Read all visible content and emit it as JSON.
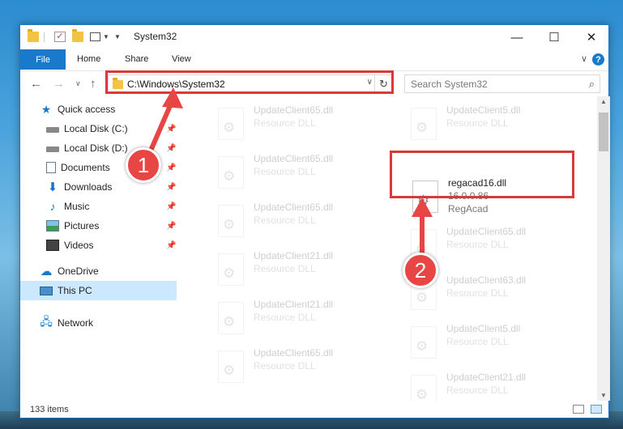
{
  "window": {
    "title": "System32",
    "minimize_glyph": "—",
    "maximize_glyph": "☐",
    "close_glyph": "✕"
  },
  "ribbon": {
    "tabs": [
      {
        "label": "File"
      },
      {
        "label": "Home"
      },
      {
        "label": "Share"
      },
      {
        "label": "View"
      }
    ],
    "help_glyph": "?"
  },
  "address": {
    "path": "C:\\Windows\\System32",
    "search_placeholder": "Search System32"
  },
  "sidebar": {
    "quick_access": "Quick access",
    "items": [
      {
        "label": "Local Disk (C:)",
        "icon": "disk-icon"
      },
      {
        "label": "Local Disk (D:)",
        "icon": "disk-icon"
      },
      {
        "label": "Documents",
        "icon": "documents-icon"
      },
      {
        "label": "Downloads",
        "icon": "downloads-icon"
      },
      {
        "label": "Music",
        "icon": "music-icon"
      },
      {
        "label": "Pictures",
        "icon": "pictures-icon"
      },
      {
        "label": "Videos",
        "icon": "videos-icon"
      }
    ],
    "onedrive": "OneDrive",
    "this_pc": "This PC",
    "network": "Network"
  },
  "files": {
    "left_column": [
      {
        "name": "UpdateClient65.dll",
        "type": "Resource DLL"
      },
      {
        "name": "UpdateClient65.dll",
        "type": "Resource DLL"
      },
      {
        "name": "UpdateClient65.dll",
        "type": "Resource DLL"
      },
      {
        "name": "UpdateClient21.dll",
        "type": "Resource DLL"
      },
      {
        "name": "UpdateClient21.dll",
        "type": "Resource DLL"
      },
      {
        "name": "UpdateClient65.dll",
        "type": "Resource DLL"
      }
    ],
    "right_column": [
      {
        "name": "UpdateClient5.dll",
        "type": "Resource DLL"
      },
      {
        "name": "UpdateClient65.dll",
        "type": "Resource DLL"
      },
      {
        "name": "UpdateClient63.dll",
        "type": "Resource DLL"
      },
      {
        "name": "UpdateClient5.dll",
        "type": "Resource DLL"
      },
      {
        "name": "UpdateClient21.dll",
        "type": "Resource DLL"
      }
    ],
    "highlighted": {
      "name": "regacad16.dll",
      "version": "16.0.0.86",
      "company": "RegAcad"
    }
  },
  "status": {
    "item_count": "133 items"
  },
  "annotations": {
    "step1": "1",
    "step2": "2",
    "color": "#e84545"
  }
}
